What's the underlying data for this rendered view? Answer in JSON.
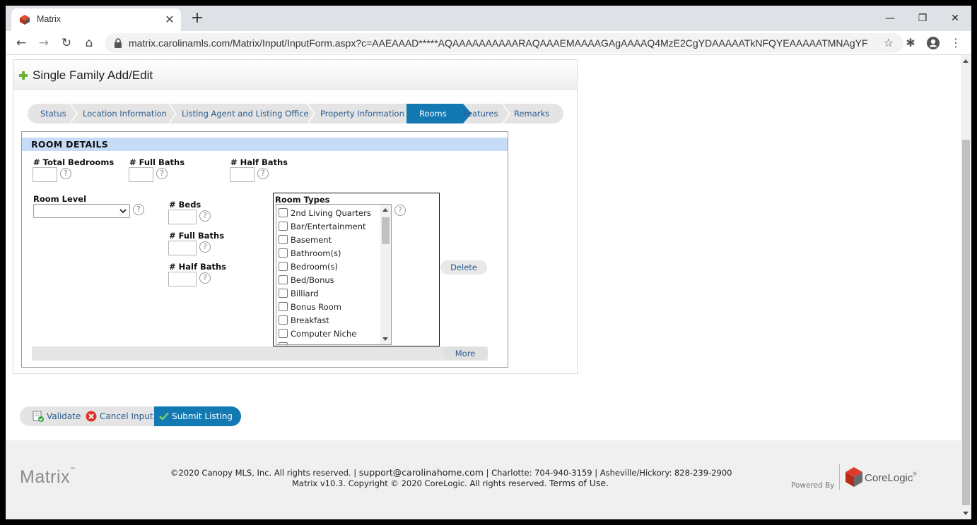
{
  "browser": {
    "tab_title": "Matrix",
    "close_glyph": "✕",
    "newtab_glyph": "+",
    "url": "matrix.carolinamls.com/Matrix/Input/InputForm.aspx?c=AAEAAAD*****AQAAAAAAAAAARAQAAAEMAAAAGAgAAAAQ4MzE2CgYDAAAAATkNFQYEAAAAATMNAgYFAAA...",
    "back_glyph": "←",
    "forward_glyph": "→",
    "reload_glyph": "↻",
    "home_glyph": "⌂",
    "star_glyph": "☆",
    "extensions_glyph": "✱",
    "menu_glyph": "⋮",
    "minimize_glyph": "—",
    "maximize_glyph": "❐",
    "winclose_glyph": "✕"
  },
  "form": {
    "title": "Single Family Add/Edit",
    "steps": [
      "Status",
      "Location Information",
      "Listing Agent and Listing Office",
      "Property Information",
      "Rooms",
      "Features",
      "Remarks"
    ],
    "active_step": "Rooms",
    "room_details": {
      "heading": "ROOM DETAILS",
      "total_bedrooms_label": "# Total Bedrooms",
      "full_baths_label": "# Full Baths",
      "half_baths_label": "# Half Baths",
      "total_bedrooms_value": "",
      "full_baths_value": "",
      "half_baths_value": "",
      "room_level_label": "Room Level",
      "room_level_value": "",
      "beds_label": "# Beds",
      "room_full_baths_label": "# Full Baths",
      "room_half_baths_label": "# Half Baths",
      "room_types_label": "Room Types",
      "room_types": [
        "2nd Living Quarters",
        "Bar/Entertainment",
        "Basement",
        "Bathroom(s)",
        "Bedroom(s)",
        "Bed/Bonus",
        "Billiard",
        "Bonus Room",
        "Breakfast",
        "Computer Niche"
      ],
      "help_glyph": "?",
      "delete_label": "Delete",
      "more_label": "More"
    }
  },
  "actions": {
    "validate_label": "Validate",
    "cancel_label": "Cancel Input",
    "submit_label": "Submit Listing"
  },
  "footer": {
    "logo_text": "Matrix",
    "logo_tm": "™",
    "copyright_prefix": "©2020 Canopy MLS, Inc. All rights reserved. | ",
    "support_email": "support@carolinahome.com",
    "phones": " | Charlotte: 704-940-3159 | Asheville/Hickory: 828-239-2900",
    "line2_prefix": "Matrix v10.3. Copyright © 2020 CoreLogic. All rights reserved. ",
    "terms_label": "Terms of Use.",
    "powered_by": "Powered By",
    "corelogic": "CoreLogic",
    "corelogic_tm": "®"
  },
  "colors": {
    "accent": "#1279b2",
    "section_header": "#c5dbf7",
    "link": "#2b5c8f"
  }
}
